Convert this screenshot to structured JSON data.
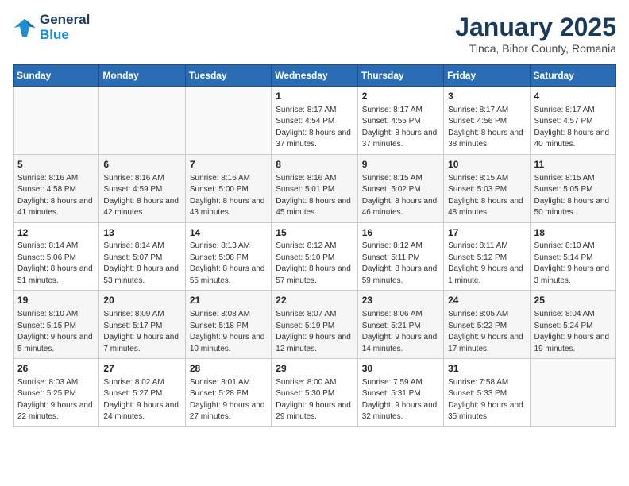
{
  "header": {
    "logo_line1": "General",
    "logo_line2": "Blue",
    "month": "January 2025",
    "location": "Tinca, Bihor County, Romania"
  },
  "days_of_week": [
    "Sunday",
    "Monday",
    "Tuesday",
    "Wednesday",
    "Thursday",
    "Friday",
    "Saturday"
  ],
  "weeks": [
    [
      {
        "day": "",
        "info": ""
      },
      {
        "day": "",
        "info": ""
      },
      {
        "day": "",
        "info": ""
      },
      {
        "day": "1",
        "info": "Sunrise: 8:17 AM\nSunset: 4:54 PM\nDaylight: 8 hours and 37 minutes."
      },
      {
        "day": "2",
        "info": "Sunrise: 8:17 AM\nSunset: 4:55 PM\nDaylight: 8 hours and 37 minutes."
      },
      {
        "day": "3",
        "info": "Sunrise: 8:17 AM\nSunset: 4:56 PM\nDaylight: 8 hours and 38 minutes."
      },
      {
        "day": "4",
        "info": "Sunrise: 8:17 AM\nSunset: 4:57 PM\nDaylight: 8 hours and 40 minutes."
      }
    ],
    [
      {
        "day": "5",
        "info": "Sunrise: 8:16 AM\nSunset: 4:58 PM\nDaylight: 8 hours and 41 minutes."
      },
      {
        "day": "6",
        "info": "Sunrise: 8:16 AM\nSunset: 4:59 PM\nDaylight: 8 hours and 42 minutes."
      },
      {
        "day": "7",
        "info": "Sunrise: 8:16 AM\nSunset: 5:00 PM\nDaylight: 8 hours and 43 minutes."
      },
      {
        "day": "8",
        "info": "Sunrise: 8:16 AM\nSunset: 5:01 PM\nDaylight: 8 hours and 45 minutes."
      },
      {
        "day": "9",
        "info": "Sunrise: 8:15 AM\nSunset: 5:02 PM\nDaylight: 8 hours and 46 minutes."
      },
      {
        "day": "10",
        "info": "Sunrise: 8:15 AM\nSunset: 5:03 PM\nDaylight: 8 hours and 48 minutes."
      },
      {
        "day": "11",
        "info": "Sunrise: 8:15 AM\nSunset: 5:05 PM\nDaylight: 8 hours and 50 minutes."
      }
    ],
    [
      {
        "day": "12",
        "info": "Sunrise: 8:14 AM\nSunset: 5:06 PM\nDaylight: 8 hours and 51 minutes."
      },
      {
        "day": "13",
        "info": "Sunrise: 8:14 AM\nSunset: 5:07 PM\nDaylight: 8 hours and 53 minutes."
      },
      {
        "day": "14",
        "info": "Sunrise: 8:13 AM\nSunset: 5:08 PM\nDaylight: 8 hours and 55 minutes."
      },
      {
        "day": "15",
        "info": "Sunrise: 8:12 AM\nSunset: 5:10 PM\nDaylight: 8 hours and 57 minutes."
      },
      {
        "day": "16",
        "info": "Sunrise: 8:12 AM\nSunset: 5:11 PM\nDaylight: 8 hours and 59 minutes."
      },
      {
        "day": "17",
        "info": "Sunrise: 8:11 AM\nSunset: 5:12 PM\nDaylight: 9 hours and 1 minute."
      },
      {
        "day": "18",
        "info": "Sunrise: 8:10 AM\nSunset: 5:14 PM\nDaylight: 9 hours and 3 minutes."
      }
    ],
    [
      {
        "day": "19",
        "info": "Sunrise: 8:10 AM\nSunset: 5:15 PM\nDaylight: 9 hours and 5 minutes."
      },
      {
        "day": "20",
        "info": "Sunrise: 8:09 AM\nSunset: 5:17 PM\nDaylight: 9 hours and 7 minutes."
      },
      {
        "day": "21",
        "info": "Sunrise: 8:08 AM\nSunset: 5:18 PM\nDaylight: 9 hours and 10 minutes."
      },
      {
        "day": "22",
        "info": "Sunrise: 8:07 AM\nSunset: 5:19 PM\nDaylight: 9 hours and 12 minutes."
      },
      {
        "day": "23",
        "info": "Sunrise: 8:06 AM\nSunset: 5:21 PM\nDaylight: 9 hours and 14 minutes."
      },
      {
        "day": "24",
        "info": "Sunrise: 8:05 AM\nSunset: 5:22 PM\nDaylight: 9 hours and 17 minutes."
      },
      {
        "day": "25",
        "info": "Sunrise: 8:04 AM\nSunset: 5:24 PM\nDaylight: 9 hours and 19 minutes."
      }
    ],
    [
      {
        "day": "26",
        "info": "Sunrise: 8:03 AM\nSunset: 5:25 PM\nDaylight: 9 hours and 22 minutes."
      },
      {
        "day": "27",
        "info": "Sunrise: 8:02 AM\nSunset: 5:27 PM\nDaylight: 9 hours and 24 minutes."
      },
      {
        "day": "28",
        "info": "Sunrise: 8:01 AM\nSunset: 5:28 PM\nDaylight: 9 hours and 27 minutes."
      },
      {
        "day": "29",
        "info": "Sunrise: 8:00 AM\nSunset: 5:30 PM\nDaylight: 9 hours and 29 minutes."
      },
      {
        "day": "30",
        "info": "Sunrise: 7:59 AM\nSunset: 5:31 PM\nDaylight: 9 hours and 32 minutes."
      },
      {
        "day": "31",
        "info": "Sunrise: 7:58 AM\nSunset: 5:33 PM\nDaylight: 9 hours and 35 minutes."
      },
      {
        "day": "",
        "info": ""
      }
    ]
  ]
}
